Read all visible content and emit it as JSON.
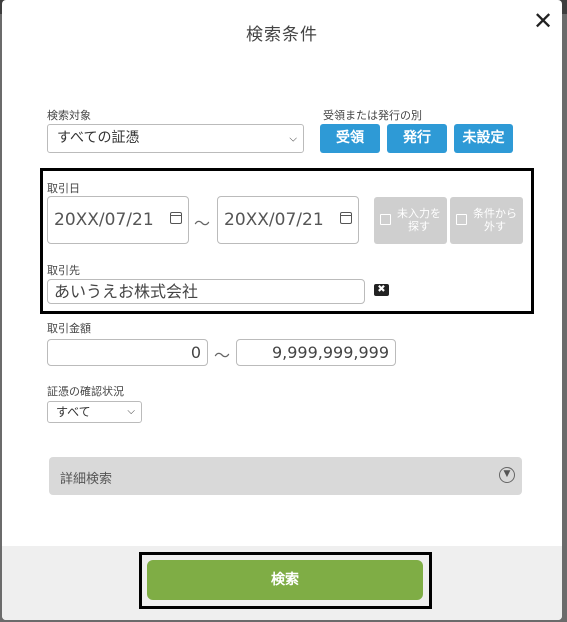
{
  "dialog": {
    "title": "検索条件",
    "close_icon": "close-icon"
  },
  "target": {
    "label": "検索対象",
    "value": "すべての証憑"
  },
  "issue_type": {
    "label": "受領または発行の別",
    "buttons": [
      "受領",
      "発行",
      "未設定"
    ],
    "color": "#2e9ad6"
  },
  "transaction_date": {
    "label": "取引日",
    "from": "20XX/07/21",
    "to": "20XX/07/21",
    "separator": "〜",
    "unentered_button": "未入力を探す",
    "exclude_button": "条件から外す"
  },
  "partner": {
    "label": "取引先",
    "value": "あいうえお株式会社"
  },
  "amount": {
    "label": "取引金額",
    "from": "0",
    "to": "9,999,999,999",
    "separator": "〜"
  },
  "confirm_status": {
    "label": "証憑の確認状況",
    "value": "すべて"
  },
  "details": {
    "label": "詳細検索"
  },
  "search_button": {
    "label": "検索",
    "color": "#7fad45"
  }
}
